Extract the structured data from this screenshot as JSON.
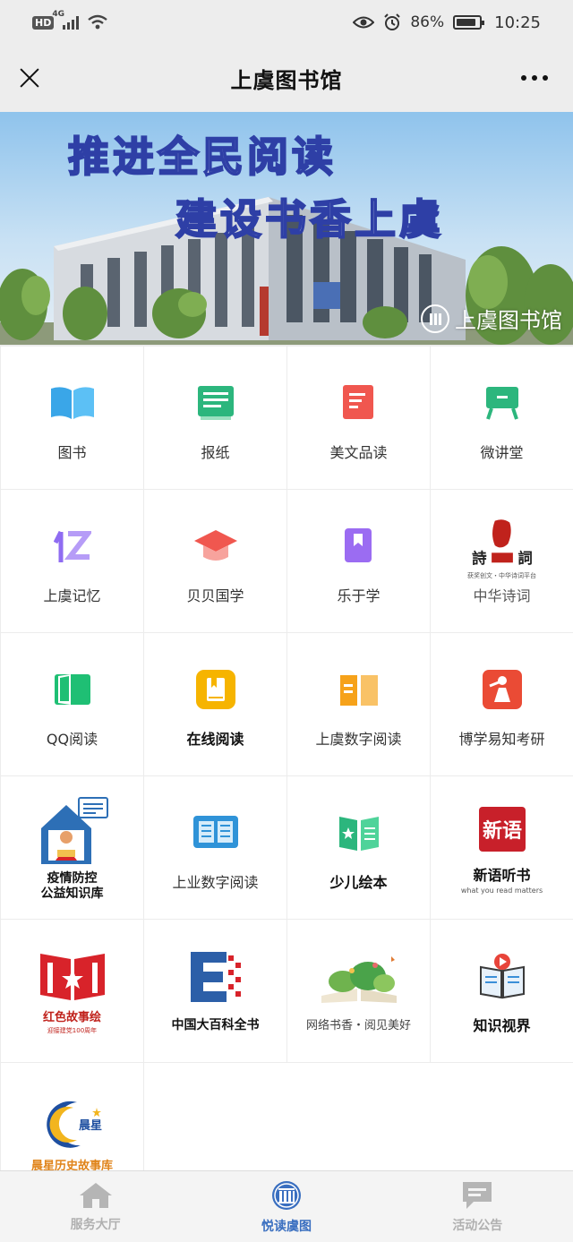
{
  "status_bar": {
    "hd": "HD",
    "network": "4G",
    "battery": "86%",
    "time": "10:25"
  },
  "nav": {
    "title": "上虞图书馆"
  },
  "banner": {
    "line1": "推进全民阅读",
    "line2": "建设书香上虞",
    "logo_text": "上虞图书馆"
  },
  "grid": {
    "items": [
      {
        "label": "图书",
        "icon": "open-book-icon",
        "color": "#3aa6e8"
      },
      {
        "label": "报纸",
        "icon": "newspaper-icon",
        "color": "#2cb67d"
      },
      {
        "label": "美文品读",
        "icon": "document-icon",
        "color": "#f0574f"
      },
      {
        "label": "微讲堂",
        "icon": "presentation-icon",
        "color": "#2cb67d"
      },
      {
        "label": "上虞记忆",
        "icon": "memory-glyph-icon",
        "color": "#9b6cf2"
      },
      {
        "label": "贝贝国学",
        "icon": "graduation-cap-icon",
        "color": "#f0574f"
      },
      {
        "label": "乐于学",
        "icon": "bookmark-book-icon",
        "color": "#8f6cf2"
      },
      {
        "label": "中华诗词",
        "icon": "poetry-seal-icon",
        "color": "#c0221c"
      },
      {
        "label": "QQ阅读",
        "icon": "qq-read-icon",
        "color": "#1fbf74"
      },
      {
        "label": "在线阅读",
        "icon": "online-read-icon",
        "color": "#f6b400"
      },
      {
        "label": "上虞数字阅读",
        "icon": "digital-book-icon",
        "color": "#f6a21a"
      },
      {
        "label": "博学易知考研",
        "icon": "study-icon",
        "color": "#ea4b35"
      },
      {
        "label": "疫情防控\n公益知识库",
        "icon": "home-reader-icon",
        "color": "#2d6fb6"
      },
      {
        "label": "上业数字阅读",
        "icon": "ebook-reader-icon",
        "color": "#2f93d8"
      },
      {
        "label": "少儿绘本",
        "icon": "star-book-icon",
        "color": "#2cb67d"
      },
      {
        "label": "新语听书",
        "icon": "xinyu-logo-icon",
        "color": "#c8202a"
      },
      {
        "label": "红色故事绘",
        "icon": "red-story-icon",
        "color": "#d8232a"
      },
      {
        "label": "中国大百科全书",
        "icon": "encyclopedia-icon",
        "color": "#d8232a"
      },
      {
        "label": "网络书香・阅见美好",
        "icon": "book-garden-icon",
        "color": "#4aa34a"
      },
      {
        "label": "知识视界",
        "icon": "video-book-icon",
        "color": "#3a8fd8"
      },
      {
        "label": "晨星历史故事库",
        "icon": "morning-star-icon",
        "color": "#e0841a"
      }
    ],
    "sublabels": {
      "poetry": "获奖创文・中华诗词平台",
      "xinyu": "what you read matters",
      "red_story": "迎接建党100周年"
    }
  },
  "tabbar": {
    "tabs": [
      {
        "label": "服务大厅",
        "icon": "home-icon",
        "active": false
      },
      {
        "label": "悦读虞图",
        "icon": "library-icon",
        "active": true
      },
      {
        "label": "活动公告",
        "icon": "message-icon",
        "active": false
      }
    ]
  }
}
